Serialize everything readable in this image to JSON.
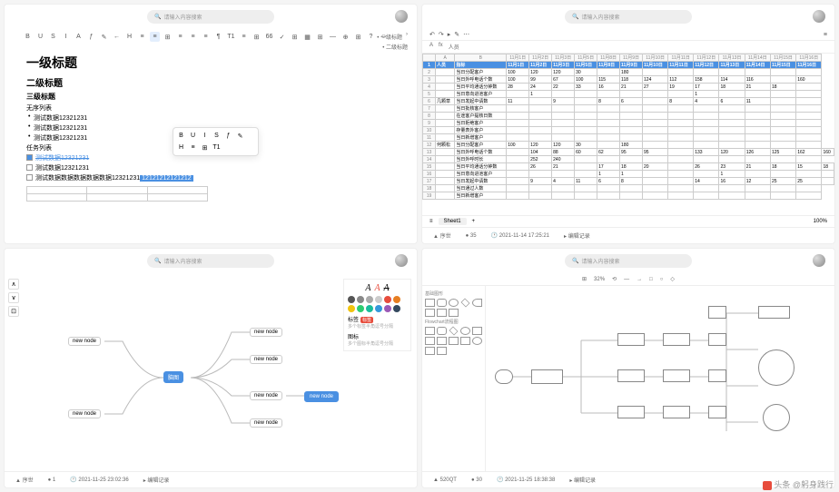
{
  "search_placeholder": "请输入内容搜索",
  "doc": {
    "h1": "一级标题",
    "h2": "二级标题",
    "h3": "三级标题",
    "ul_label": "无序列表",
    "li1": "测试数据12321231",
    "li2": "测试数据12321231",
    "li3": "测试数据12321231",
    "task_label": "任务列表",
    "task1": "测试数据12321231",
    "task2": "测试数据12321231",
    "task3": "测试数据数据数据数据数据12321231",
    "selected": "12121212121212",
    "toc1": "一级标题",
    "toc2": "二级标题",
    "tb": [
      "B",
      "U",
      "S",
      "I",
      "A",
      "ƒ",
      "✎",
      "←",
      "H",
      "≡",
      "≡",
      "⊞",
      "≡",
      "≡",
      "≡",
      "¶",
      "T1",
      "≡",
      "⊞",
      "66",
      "✓",
      "⊞",
      "▦",
      "⊞",
      "—",
      "⊕",
      "⊞",
      "?",
      "☺"
    ],
    "float": [
      "B",
      "U",
      "I",
      "S",
      "ƒ",
      "✎",
      "H",
      "≡",
      "⊞",
      "T1"
    ]
  },
  "sheet": {
    "fx_cell": "A",
    "fx_label": "fx",
    "fx_val": "人员",
    "tab": "Sheet1",
    "zoom": "100%",
    "cols": [
      "A",
      "B",
      "11月1日",
      "11月2日",
      "11月3日",
      "11月5日",
      "11月8日",
      "11月9日",
      "11月10日",
      "11月11日",
      "11月12日",
      "11月13日",
      "11月14日",
      "11月15日",
      "11月16日"
    ],
    "hdr": [
      "人员",
      "指标"
    ],
    "groups": [
      {
        "name": "",
        "rows": [
          {
            "label": "当日分配客户",
            "vals": [
              "100",
              "120",
              "120",
              "30",
              "",
              "180",
              "",
              "",
              "",
              "",
              "",
              "",
              ""
            ]
          },
          {
            "label": "当日外呼电话个数",
            "vals": [
              "100",
              "99",
              "67",
              "100",
              "115",
              "118",
              "124",
              "112",
              "158",
              "114",
              "116",
              "",
              "160"
            ]
          },
          {
            "label": "当日平均通话分钟数",
            "vals": [
              "28",
              "24",
              "22",
              "33",
              "16",
              "21",
              "27",
              "19",
              "17",
              "18",
              "21",
              "18",
              ""
            ]
          },
          {
            "label": "当日意向进池客户",
            "vals": [
              "",
              "1",
              "",
              "",
              "",
              "",
              "",
              "",
              "1",
              "",
              "",
              "",
              ""
            ]
          }
        ]
      },
      {
        "name": "几颗草",
        "rows": [
          {
            "label": "当日发起中请数",
            "vals": [
              "11",
              "",
              "9",
              "",
              "8",
              "6",
              "",
              "8",
              "4",
              "6",
              "11",
              "",
              ""
            ]
          },
          {
            "label": "当日批核客户",
            "vals": [
              "",
              "",
              "",
              "",
              "",
              "",
              "",
              "",
              "",
              "",
              "",
              "",
              ""
            ]
          },
          {
            "label": "在途客户提核日数",
            "vals": [
              "",
              "",
              "",
              "",
              "",
              "",
              "",
              "",
              "",
              "",
              "",
              "",
              ""
            ]
          },
          {
            "label": "当日拒绝客户",
            "vals": [
              "",
              "",
              "",
              "",
              "",
              "",
              "",
              "",
              "",
              "",
              "",
              "",
              ""
            ]
          },
          {
            "label": "存量表外客户",
            "vals": [
              "",
              "",
              "",
              "",
              "",
              "",
              "",
              "",
              "",
              "",
              "",
              "",
              ""
            ]
          },
          {
            "label": "当日新增客户",
            "vals": [
              "",
              "",
              "",
              "",
              "",
              "",
              "",
              "",
              "",
              "",
              "",
              "",
              ""
            ]
          }
        ]
      },
      {
        "name": "何颗松",
        "rows": [
          {
            "label": "当日分配客户",
            "vals": [
              "100",
              "120",
              "120",
              "30",
              "",
              "180",
              "",
              "",
              "",
              "",
              "",
              "",
              ""
            ]
          },
          {
            "label": "当日外呼电话个数",
            "vals": [
              "",
              "104",
              "88",
              "60",
              "62",
              "95",
              "95",
              "",
              "133",
              "120",
              "126",
              "125",
              "162",
              "160"
            ]
          },
          {
            "label": "当日外呼时长",
            "vals": [
              "",
              "252",
              "240",
              "",
              "",
              "",
              "",
              "",
              "",
              "",
              "",
              "",
              ""
            ]
          },
          {
            "label": "当日平均通话分钟数",
            "vals": [
              "",
              "26",
              "21",
              "",
              "17",
              "18",
              "20",
              "",
              "26",
              "23",
              "21",
              "18",
              "15",
              "18"
            ]
          },
          {
            "label": "当日意向进池客户",
            "vals": [
              "",
              "",
              "",
              "",
              "1",
              "1",
              "",
              "",
              "",
              "1",
              "",
              "",
              "",
              ""
            ]
          },
          {
            "label": "当日发起中请数",
            "vals": [
              "",
              "9",
              "4",
              "11",
              "6",
              "8",
              "",
              "",
              "14",
              "16",
              "12",
              "25",
              "25",
              ""
            ]
          },
          {
            "label": "当日通过人数",
            "vals": [
              "",
              "",
              "",
              "",
              "",
              "",
              "",
              "",
              "",
              "",
              "",
              "",
              ""
            ]
          },
          {
            "label": "当日新增客户",
            "vals": [
              "",
              "",
              "",
              "",
              "",
              "",
              "",
              "",
              "",
              "",
              "",
              "",
              ""
            ]
          }
        ]
      }
    ],
    "footer_user": "序世",
    "footer_count": "35",
    "footer_time": "2021-11-14 17:25:21",
    "footer_edit": "编辑记录"
  },
  "mindmap": {
    "root": "脑图",
    "node": "new node",
    "panel_font": "A",
    "panel_label1": "标签",
    "panel_tag": "标签",
    "panel_hint1": "多个标签半角逗号分隔",
    "panel_label2": "图标",
    "panel_hint2": "多个图标半角逗号分隔",
    "colors": [
      "#555",
      "#888",
      "#aaa",
      "#ccc",
      "#e74c3c",
      "#e67e22",
      "#f1c40f",
      "#2ecc71",
      "#1abc9c",
      "#3498db",
      "#9b59b6",
      "#34495e"
    ],
    "footer_user": "序世",
    "footer_count": "1",
    "footer_time": "2021-11-25 23:02:36",
    "footer_edit": "编辑记录"
  },
  "flow": {
    "tb": [
      "⊞",
      "32%",
      "⟲",
      "—",
      "→",
      "□",
      "○",
      "◇"
    ],
    "cat1": "基础图形",
    "cat2": "Flowchart流程图",
    "footer_user": "520QT",
    "footer_count": "30",
    "footer_time": "2021-11-25 18:38:38",
    "footer_edit": "编辑记录"
  },
  "watermark": "头条 @躬身践行"
}
